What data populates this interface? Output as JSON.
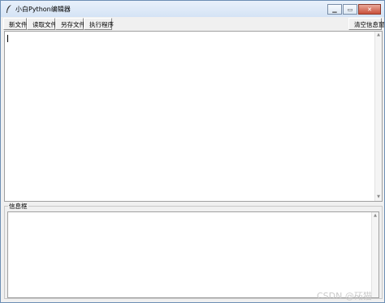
{
  "window": {
    "title": "小白Python编辑器",
    "icon": "feather-icon",
    "controls": {
      "minimize": "minimize-icon",
      "maximize": "maximize-icon",
      "close": "close-icon"
    }
  },
  "toolbar": {
    "new_file": "新文件",
    "open_file": "读取文件",
    "save_as": "另存文件",
    "run_program": "执行程序",
    "clear_info": "清空信息窗"
  },
  "editor": {
    "content": ""
  },
  "info_panel": {
    "label": "信息框",
    "content": ""
  },
  "watermark": "CSDN @砳猫"
}
